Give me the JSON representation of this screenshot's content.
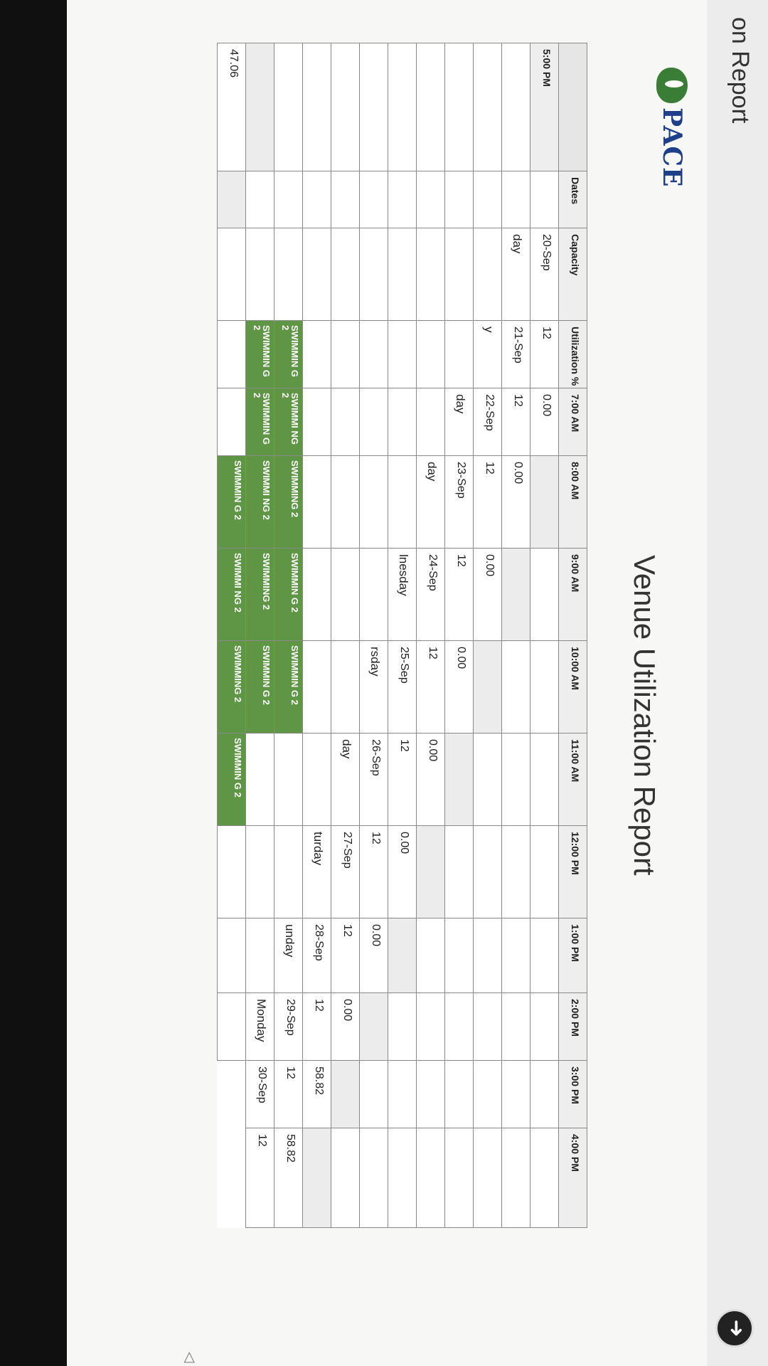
{
  "window": {
    "title_partial": "on Report"
  },
  "logo": {
    "text": "PACE"
  },
  "report": {
    "title": "Venue Utilization Report"
  },
  "table": {
    "headers": [
      "Dates",
      "Capacity",
      "Utilization %",
      "7:00 AM",
      "8:00 AM",
      "9:00 AM",
      "10:00 AM",
      "11:00 AM",
      "12:00 PM",
      "1:00 PM",
      "2:00 PM",
      "3:00 PM",
      "4:00 PM",
      "5:00 PM"
    ],
    "rows": [
      {
        "day": "",
        "date": "20-Sep",
        "capacity": "12",
        "utilization": "0.00",
        "slots": [
          "",
          "",
          "",
          "",
          "",
          "",
          "",
          "",
          "",
          "",
          ""
        ]
      },
      {
        "day": "day",
        "date": "21-Sep",
        "capacity": "12",
        "utilization": "0.00",
        "slots": [
          "",
          "",
          "",
          "",
          "",
          "",
          "",
          "",
          "",
          "",
          ""
        ]
      },
      {
        "day": "y",
        "date": "22-Sep",
        "capacity": "12",
        "utilization": "0.00",
        "slots": [
          "",
          "",
          "",
          "",
          "",
          "",
          "",
          "",
          "",
          "",
          ""
        ]
      },
      {
        "day": "day",
        "date": "23-Sep",
        "capacity": "12",
        "utilization": "0.00",
        "slots": [
          "",
          "",
          "",
          "",
          "",
          "",
          "",
          "",
          "",
          "",
          ""
        ]
      },
      {
        "day": "day",
        "date": "24-Sep",
        "capacity": "12",
        "utilization": "0.00",
        "slots": [
          "",
          "",
          "",
          "",
          "",
          "",
          "",
          "",
          "",
          "",
          ""
        ]
      },
      {
        "day": "lnesday",
        "date": "25-Sep",
        "capacity": "12",
        "utilization": "0.00",
        "slots": [
          "",
          "",
          "",
          "",
          "",
          "",
          "",
          "",
          "",
          "",
          ""
        ]
      },
      {
        "day": "rsday",
        "date": "26-Sep",
        "capacity": "12",
        "utilization": "0.00",
        "slots": [
          "",
          "",
          "",
          "",
          "",
          "",
          "",
          "",
          "",
          "",
          ""
        ]
      },
      {
        "day": "day",
        "date": "27-Sep",
        "capacity": "12",
        "utilization": "0.00",
        "slots": [
          "",
          "",
          "",
          "",
          "",
          "",
          "",
          "",
          "",
          "",
          ""
        ]
      },
      {
        "day": "turday",
        "date": "28-Sep",
        "capacity": "12",
        "utilization": "58.82",
        "slots": [
          "",
          "",
          "",
          "",
          "SWIMMIN G 2",
          "SWIMMI NG 2",
          "SWIMMING 2",
          "SWIMMIN G 2",
          "SWIMMIN G 2",
          "",
          ""
        ]
      },
      {
        "day": "unday",
        "date": "29-Sep",
        "capacity": "12",
        "utilization": "58.82",
        "slots": [
          "",
          "",
          "",
          "SWIMMIN G 2",
          "SWIMMIN G 2",
          "SWIMMI NG 2",
          "SWIMMING 2",
          "SWIMMIN G 2",
          "",
          "",
          ""
        ]
      },
      {
        "day": "Monday",
        "date": "30-Sep",
        "capacity": "12",
        "utilization": "47.06",
        "slots": [
          "",
          "",
          "",
          "",
          "SWIMMIN G 2",
          "SWIMMI NG 2",
          "SWIMMING 2",
          "SWIMMIN G 2",
          "",
          "",
          ""
        ]
      }
    ]
  },
  "colors": {
    "booked": "#5f9646",
    "header_bg": "#eeeeee",
    "brand_blue": "#1e3f8a",
    "brand_green": "#3a7d36"
  },
  "icons": {
    "nav": "circle-arrow-icon",
    "cursor": "arrow-icon"
  }
}
